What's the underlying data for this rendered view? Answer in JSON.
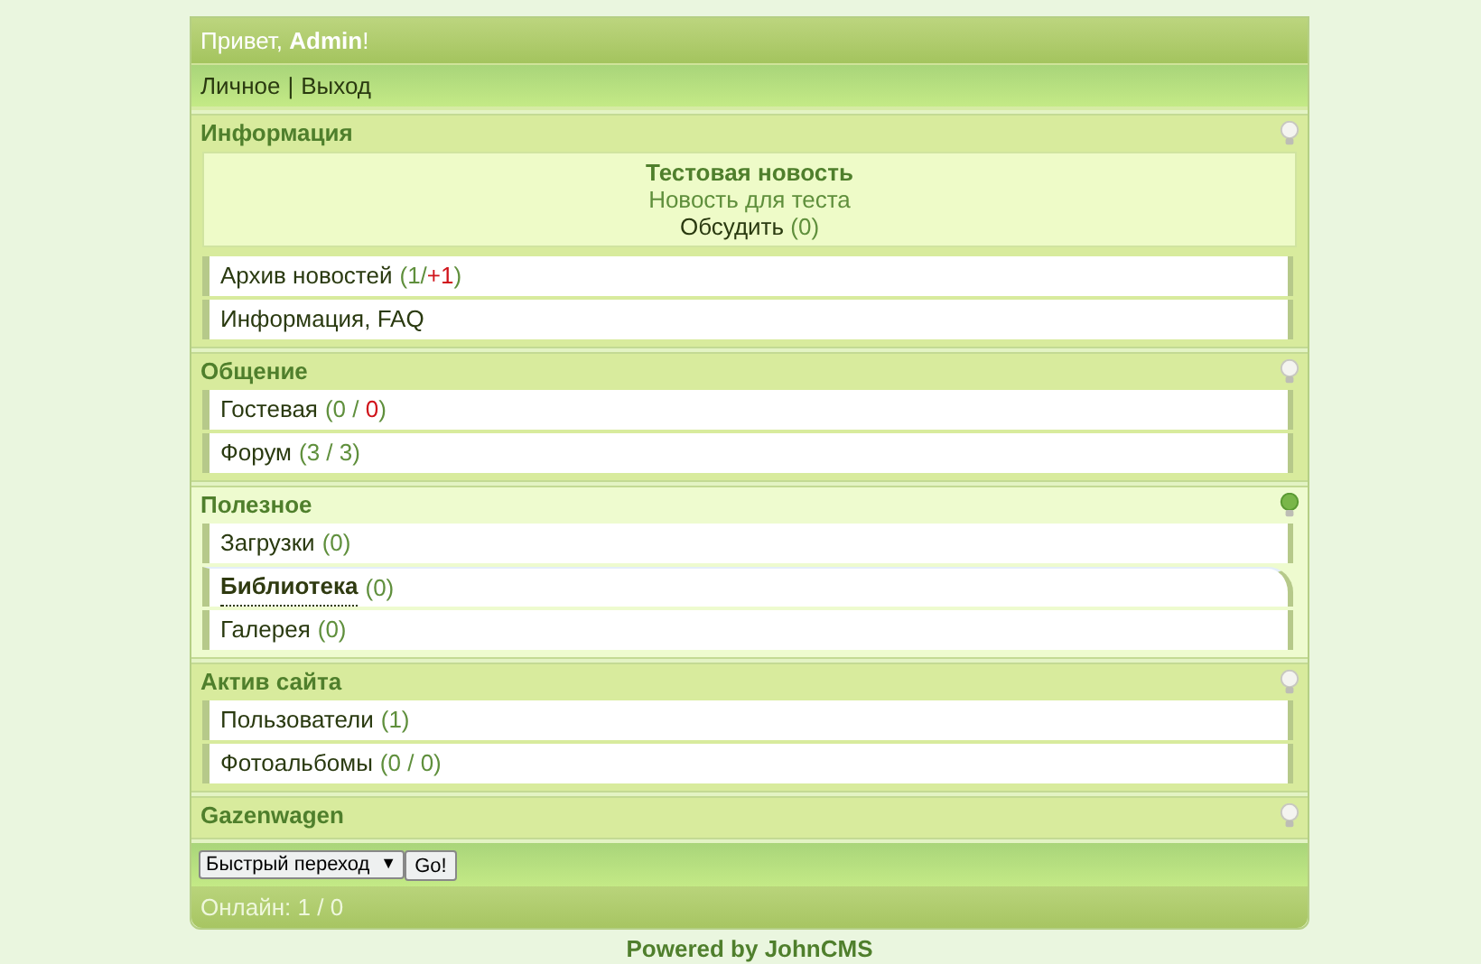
{
  "greeting": {
    "prefix": "Привет, ",
    "user": "Admin",
    "suffix": "!"
  },
  "nav": [
    {
      "label": "Личное"
    },
    {
      "label": "Выход"
    }
  ],
  "nav_separator": "|",
  "sections": [
    {
      "title": "Информация",
      "lit": false,
      "news": {
        "title": "Тестовая новость",
        "text": "Новость для теста",
        "link": "Обсудить",
        "count": "(0)"
      },
      "items": [
        {
          "label": "Архив новостей",
          "hovered": false,
          "parts": [
            {
              "text": "(1/",
              "alert": false
            },
            {
              "text": "+1",
              "alert": true
            },
            {
              "text": ")",
              "alert": false
            }
          ]
        },
        {
          "label": "Информация, FAQ",
          "hovered": false
        }
      ]
    },
    {
      "title": "Общение",
      "lit": false,
      "items": [
        {
          "label": "Гостевая",
          "hovered": false,
          "parts": [
            {
              "text": "(0 / ",
              "alert": false
            },
            {
              "text": "0",
              "alert": true
            },
            {
              "text": ")",
              "alert": false
            }
          ]
        },
        {
          "label": "Форум",
          "hovered": false,
          "parts": [
            {
              "text": "(3 / 3)",
              "alert": false
            }
          ]
        }
      ]
    },
    {
      "title": "Полезное",
      "lit": true,
      "items": [
        {
          "label": "Загрузки",
          "hovered": false,
          "parts": [
            {
              "text": "(0)",
              "alert": false
            }
          ]
        },
        {
          "label": "Библиотека",
          "hovered": true,
          "parts": [
            {
              "text": "(0)",
              "alert": false
            }
          ]
        },
        {
          "label": "Галерея",
          "hovered": false,
          "parts": [
            {
              "text": "(0)",
              "alert": false
            }
          ]
        }
      ]
    },
    {
      "title": "Актив сайта",
      "lit": false,
      "items": [
        {
          "label": "Пользователи",
          "hovered": false,
          "parts": [
            {
              "text": "(1)",
              "alert": false
            }
          ]
        },
        {
          "label": "Фотоальбомы",
          "hovered": false,
          "parts": [
            {
              "text": "(0 / 0)",
              "alert": false
            }
          ]
        }
      ]
    },
    {
      "title": "Gazenwagen",
      "lit": false
    }
  ],
  "quick_jump": {
    "value": "Быстрый переход",
    "arrow": "▼",
    "button": "Go!"
  },
  "online": "Онлайн: 1 / 0",
  "footer": "Powered by JohnCMS"
}
